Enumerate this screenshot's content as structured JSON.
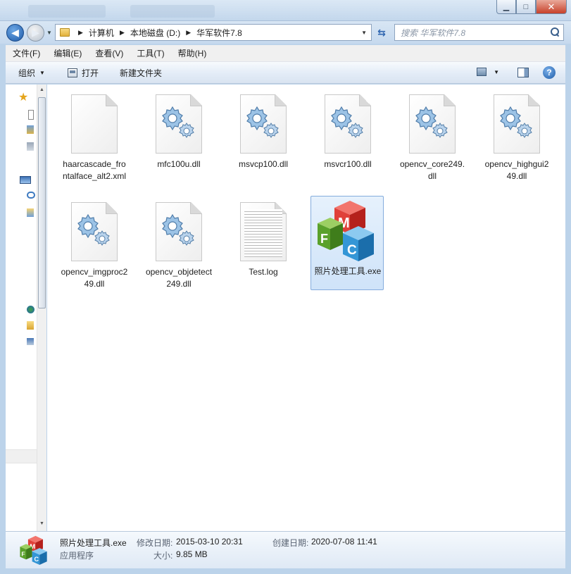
{
  "window": {
    "buttons": {
      "minimize": "▁",
      "maximize": "□",
      "close": "✕"
    }
  },
  "nav": {
    "back_glyph": "◀",
    "forward_glyph": "▶",
    "breadcrumbs": [
      "计算机",
      "本地磁盘 (D:)",
      "华军软件7.8"
    ],
    "search_placeholder": "搜索 华军软件7.8"
  },
  "menu": [
    "文件(F)",
    "编辑(E)",
    "查看(V)",
    "工具(T)",
    "帮助(H)"
  ],
  "toolbar": {
    "organize": "组织",
    "open": "打开",
    "new_folder": "新建文件夹",
    "help": "?"
  },
  "files": [
    {
      "name": "haarcascade_frontalface_alt2.xml",
      "icon": "blank-document-icon"
    },
    {
      "name": "mfc100u.dll",
      "icon": "dll-gear-icon"
    },
    {
      "name": "msvcp100.dll",
      "icon": "dll-gear-icon"
    },
    {
      "name": "msvcr100.dll",
      "icon": "dll-gear-icon"
    },
    {
      "name": "opencv_core249.dll",
      "icon": "dll-gear-icon"
    },
    {
      "name": "opencv_highgui249.dll",
      "icon": "dll-gear-icon"
    },
    {
      "name": "opencv_imgproc249.dll",
      "icon": "dll-gear-icon"
    },
    {
      "name": "opencv_objdetect249.dll",
      "icon": "dll-gear-icon"
    },
    {
      "name": "Test.log",
      "icon": "text-document-icon"
    },
    {
      "name": "照片处理工具.exe",
      "icon": "mfc-app-icon",
      "selected": true
    }
  ],
  "details": {
    "name": "照片处理工具.exe",
    "type": "应用程序",
    "modified_label": "修改日期:",
    "modified_value": "2015-03-10 20:31",
    "size_label": "大小:",
    "size_value": "9.85 MB",
    "created_label": "创建日期:",
    "created_value": "2020-07-08 11:41"
  },
  "colors": {
    "selection": "#cfe3f9",
    "selection_border": "#84acdd",
    "chrome": "#c6d9ee"
  }
}
